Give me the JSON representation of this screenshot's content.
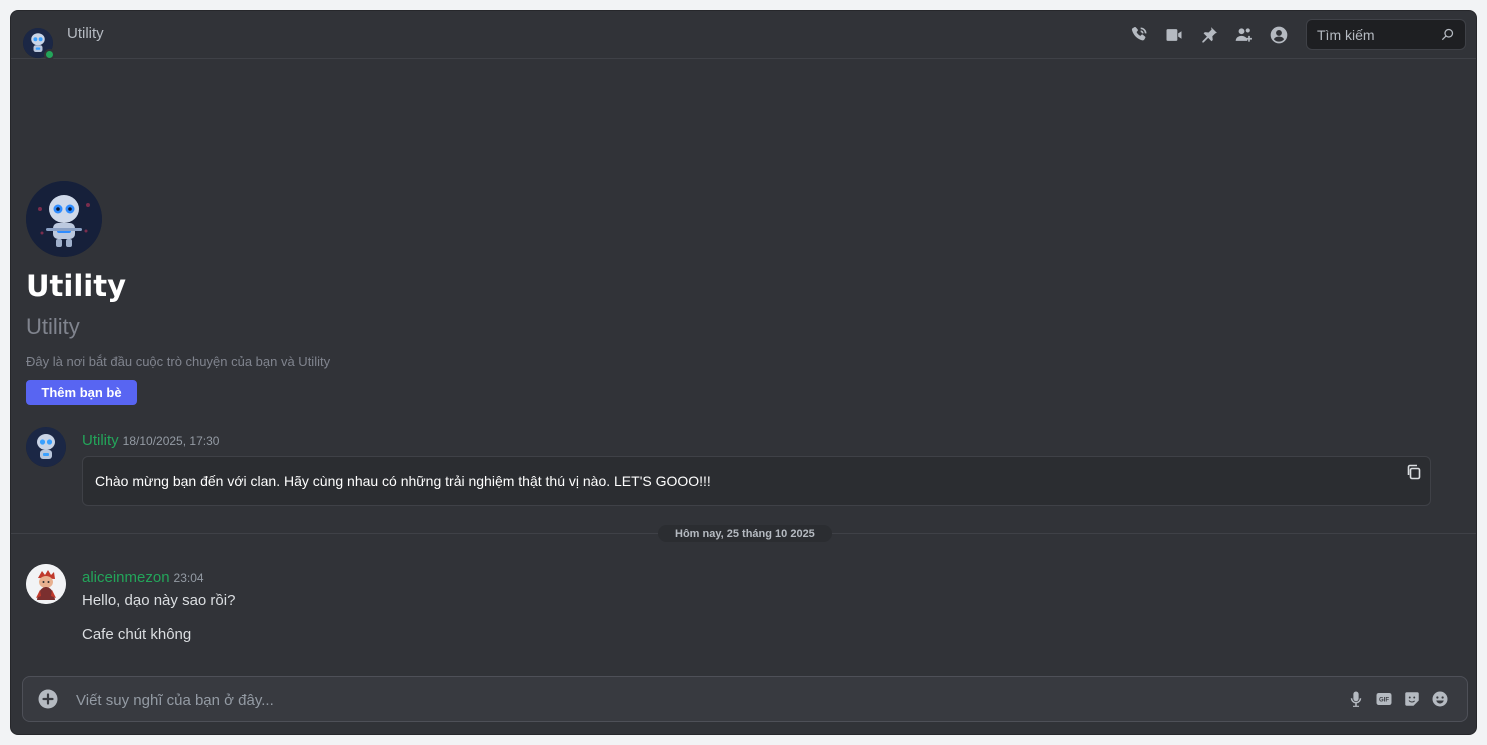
{
  "header": {
    "title": "Utility",
    "search_placeholder": "Tìm kiếm",
    "icons": [
      "phone-call-icon",
      "video-camera-icon",
      "pin-icon",
      "add-member-icon",
      "user-profile-icon",
      "search-icon"
    ]
  },
  "welcome": {
    "name": "Utility",
    "handle": "Utility",
    "description": "Đây là nơi bắt đầu cuộc trò chuyện của bạn và Utility",
    "add_friend_label": "Thêm bạn bè"
  },
  "messages": [
    {
      "author": "Utility",
      "timestamp": "18/10/2025, 17:30",
      "embed_text": "Chào mừng bạn đến với clan. Hãy cùng nhau có những trải nghiệm thật thú vị nào. LET'S GOOO!!!"
    },
    {
      "author": "aliceinmezon",
      "timestamp": "23:04",
      "lines": [
        "Hello, dạo này sao rồi?",
        "Cafe chút không"
      ]
    }
  ],
  "date_divider": "Hôm nay, 25 tháng 10 2025",
  "composer": {
    "placeholder": "Viết suy nghĩ của bạn ở đây...",
    "tools": [
      "microphone-icon",
      "gif-icon",
      "sticker-icon",
      "emoji-icon"
    ]
  },
  "colors": {
    "background": "#313338",
    "accent": "#5865f2",
    "username_green": "#23a55a",
    "online_status": "#23a55a"
  }
}
